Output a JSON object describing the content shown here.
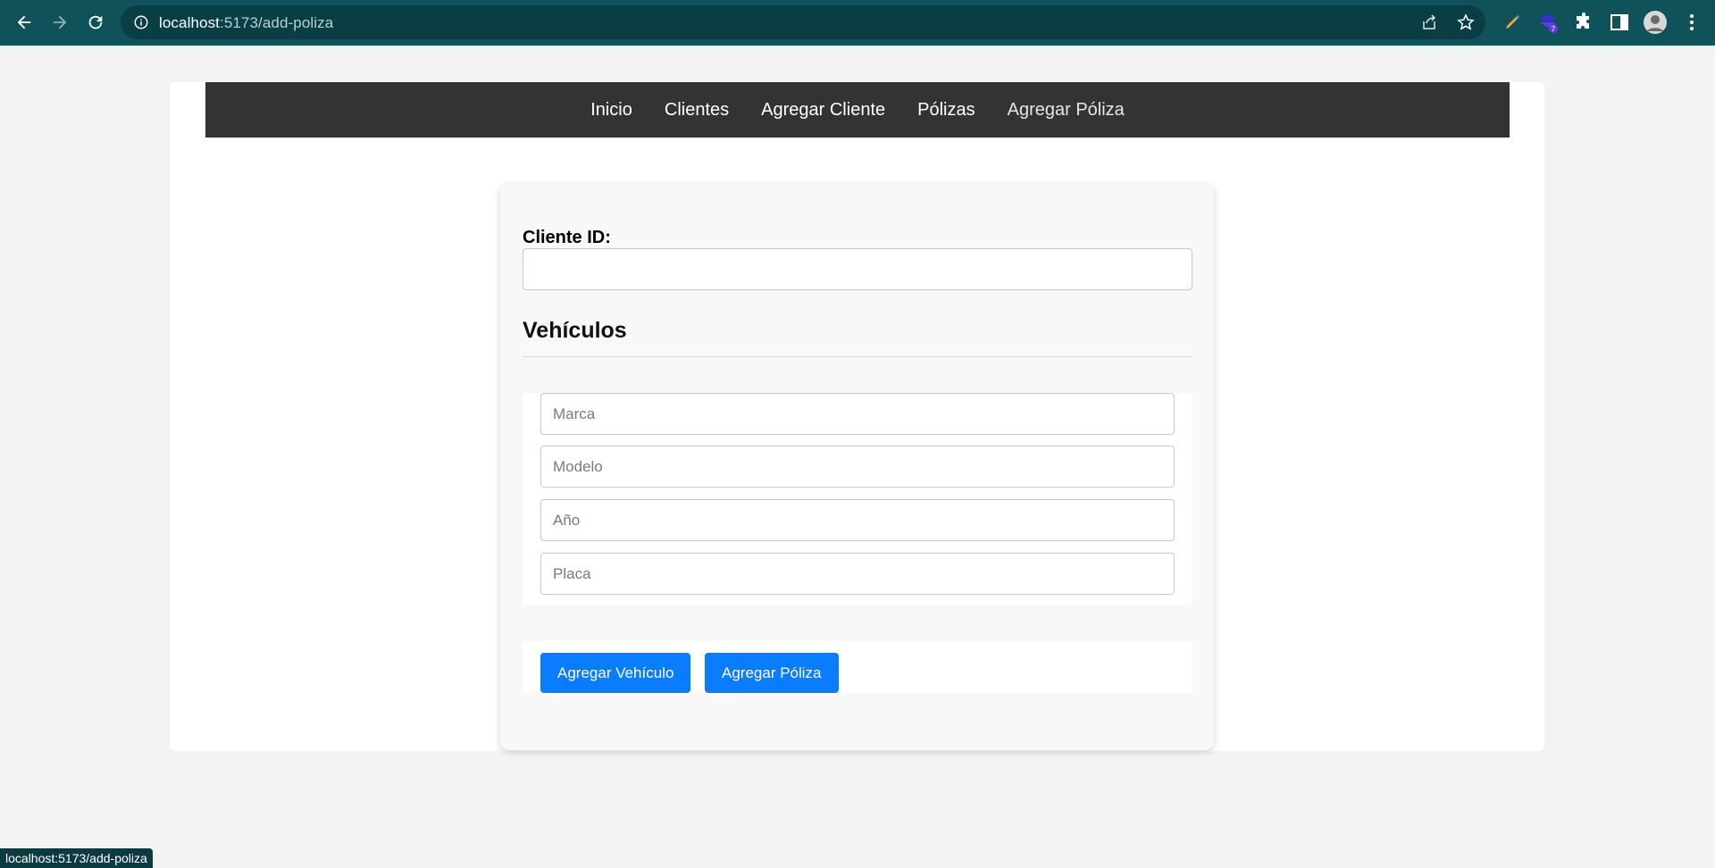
{
  "browser": {
    "url_host": "localhost",
    "url_path": ":5173/add-poliza",
    "extension_badge": "7"
  },
  "nav": {
    "items": [
      {
        "label": "Inicio"
      },
      {
        "label": "Clientes"
      },
      {
        "label": "Agregar Cliente"
      },
      {
        "label": "Pólizas"
      },
      {
        "label": "Agregar Póliza"
      }
    ]
  },
  "form": {
    "cliente_label": "Cliente ID:",
    "cliente_value": "",
    "section_title": "Vehículos",
    "fields": {
      "marca_placeholder": "Marca",
      "modelo_placeholder": "Modelo",
      "anio_placeholder": "Año",
      "placa_placeholder": "Placa"
    },
    "buttons": {
      "add_vehicle": "Agregar Vehículo",
      "add_policy": "Agregar Póliza"
    }
  },
  "status_bar": {
    "text": "localhost:5173/add-poliza"
  },
  "colors": {
    "chrome_bg": "#0f5259",
    "nav_bg": "#333333",
    "button_bg": "#0a7cff"
  }
}
